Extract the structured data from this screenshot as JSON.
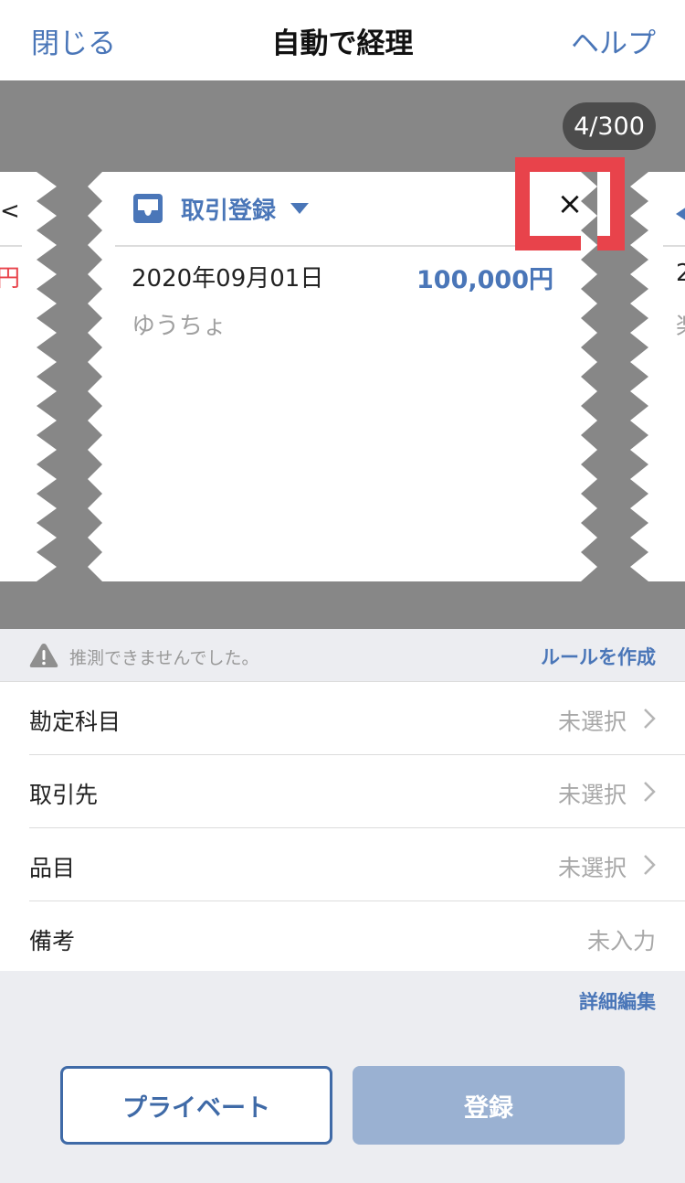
{
  "header": {
    "close_label": "閉じる",
    "title": "自動で経理",
    "help_label": "ヘルプ"
  },
  "carousel": {
    "counter": "4/300",
    "current_card": {
      "title": "取引登録",
      "close_symbol": "×",
      "date": "2020年09月01日",
      "amount": "100,000円",
      "description": "ゆうちょ",
      "icon": "inbox-icon"
    },
    "prev_card": {
      "icon_symbol": "<",
      "amount_fragment": "円"
    },
    "next_card": {
      "date_fragment": "2",
      "desc_fragment": "楽"
    }
  },
  "notice": {
    "text": "推測できませんでした。",
    "action_label": "ルールを作成",
    "icon": "warning-icon"
  },
  "form": {
    "rows": [
      {
        "label": "勘定科目",
        "value": "未選択"
      },
      {
        "label": "取引先",
        "value": "未選択"
      },
      {
        "label": "品目",
        "value": "未選択"
      },
      {
        "label": "備考",
        "value": "未入力"
      }
    ]
  },
  "footer": {
    "detail_edit_label": "詳細編集",
    "private_label": "プライベート",
    "register_label": "登録"
  },
  "colors": {
    "accent": "#4a76b8",
    "highlight": "#e8434b",
    "band_gray": "#878787",
    "register_disabled": "#9ab1d2"
  }
}
